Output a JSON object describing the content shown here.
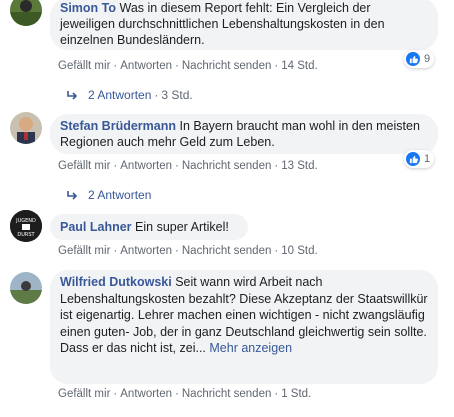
{
  "comments": [
    {
      "author": "Simon To",
      "text": "Was in diesem Report fehlt: Ein Vergleich der jeweiligen durchschnittlichen Lebenshaltungskosten in den einzelnen Bundesländern.",
      "actions": [
        "Gefällt mir",
        "Antworten",
        "Nachricht senden"
      ],
      "time": "14 Std.",
      "likes": "9",
      "replies_label": "2 Antworten",
      "replies_time": "3 Std."
    },
    {
      "author": "Stefan Brüdermann",
      "text": "In Bayern braucht man wohl in den meisten Regionen auch mehr Geld zum Leben.",
      "actions": [
        "Gefällt mir",
        "Antworten",
        "Nachricht senden"
      ],
      "time": "13 Std.",
      "likes": "1",
      "replies_label": "2 Antworten"
    },
    {
      "author": "Paul Lahner",
      "text": "Ein super Artikel!",
      "actions": [
        "Gefällt mir",
        "Antworten",
        "Nachricht senden"
      ],
      "time": "10 Std.",
      "avatar_text": "JUGEND ... DURST"
    },
    {
      "author": "Wilfried Dutkowski",
      "text": "Seit wann wird Arbeit nach Lebenshaltungskosten bezahlt? Diese Akzeptanz der Staatswillkür ist eigenartig. Lehrer machen einen wichtigen - nicht zwangsläufig einen guten- Job, der in ganz Deutschland gleichwertig sein sollte. Dass er das nicht ist, zei...",
      "more": "Mehr anzeigen",
      "actions": [
        "Gefällt mir",
        "Antworten",
        "Nachricht senden"
      ],
      "time": "1 Std."
    }
  ],
  "separator": "·",
  "colors": {
    "author": "#385898",
    "bubble": "#f2f3f5",
    "like": "#1877f2",
    "meta": "#606770"
  }
}
